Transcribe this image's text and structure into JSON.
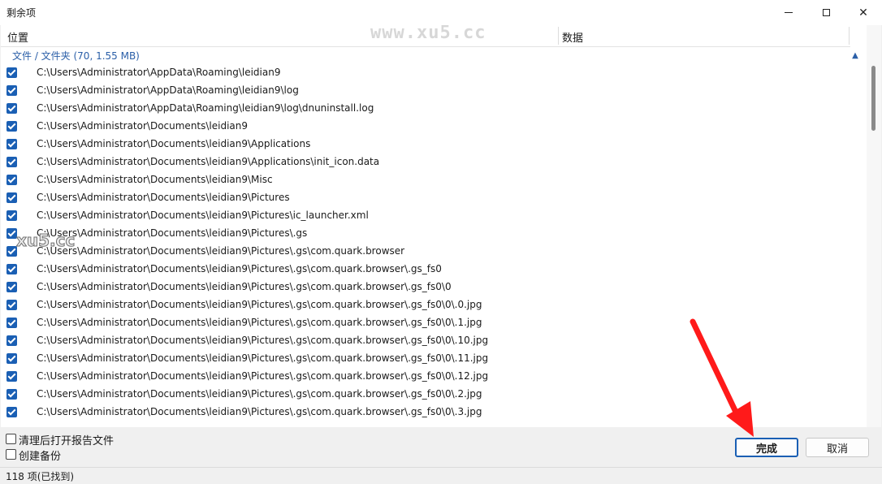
{
  "window": {
    "title": "剩余项"
  },
  "watermark_top": "www.xu5.cc",
  "watermark_left": "xu5.cc",
  "columns": {
    "location": "位置",
    "data": "数据"
  },
  "group": {
    "label": "文件 / 文件夹 (70, 1.55 MB)"
  },
  "rows": [
    "C:\\Users\\Administrator\\AppData\\Roaming\\leidian9",
    "C:\\Users\\Administrator\\AppData\\Roaming\\leidian9\\log",
    "C:\\Users\\Administrator\\AppData\\Roaming\\leidian9\\log\\dnuninstall.log",
    "C:\\Users\\Administrator\\Documents\\leidian9",
    "C:\\Users\\Administrator\\Documents\\leidian9\\Applications",
    "C:\\Users\\Administrator\\Documents\\leidian9\\Applications\\init_icon.data",
    "C:\\Users\\Administrator\\Documents\\leidian9\\Misc",
    "C:\\Users\\Administrator\\Documents\\leidian9\\Pictures",
    "C:\\Users\\Administrator\\Documents\\leidian9\\Pictures\\ic_launcher.xml",
    "C:\\Users\\Administrator\\Documents\\leidian9\\Pictures\\.gs",
    "C:\\Users\\Administrator\\Documents\\leidian9\\Pictures\\.gs\\com.quark.browser",
    "C:\\Users\\Administrator\\Documents\\leidian9\\Pictures\\.gs\\com.quark.browser\\.gs_fs0",
    "C:\\Users\\Administrator\\Documents\\leidian9\\Pictures\\.gs\\com.quark.browser\\.gs_fs0\\0",
    "C:\\Users\\Administrator\\Documents\\leidian9\\Pictures\\.gs\\com.quark.browser\\.gs_fs0\\0\\.0.jpg",
    "C:\\Users\\Administrator\\Documents\\leidian9\\Pictures\\.gs\\com.quark.browser\\.gs_fs0\\0\\.1.jpg",
    "C:\\Users\\Administrator\\Documents\\leidian9\\Pictures\\.gs\\com.quark.browser\\.gs_fs0\\0\\.10.jpg",
    "C:\\Users\\Administrator\\Documents\\leidian9\\Pictures\\.gs\\com.quark.browser\\.gs_fs0\\0\\.11.jpg",
    "C:\\Users\\Administrator\\Documents\\leidian9\\Pictures\\.gs\\com.quark.browser\\.gs_fs0\\0\\.12.jpg",
    "C:\\Users\\Administrator\\Documents\\leidian9\\Pictures\\.gs\\com.quark.browser\\.gs_fs0\\0\\.2.jpg",
    "C:\\Users\\Administrator\\Documents\\leidian9\\Pictures\\.gs\\com.quark.browser\\.gs_fs0\\0\\.3.jpg"
  ],
  "options": {
    "open_report": "清理后打开报告文件",
    "create_backup": "创建备份"
  },
  "buttons": {
    "ok": "完成",
    "cancel": "取消"
  },
  "status": {
    "text": "118 项(已找到)"
  },
  "colors": {
    "accent": "#1a5fb4",
    "arrow": "#ff1a1a"
  }
}
